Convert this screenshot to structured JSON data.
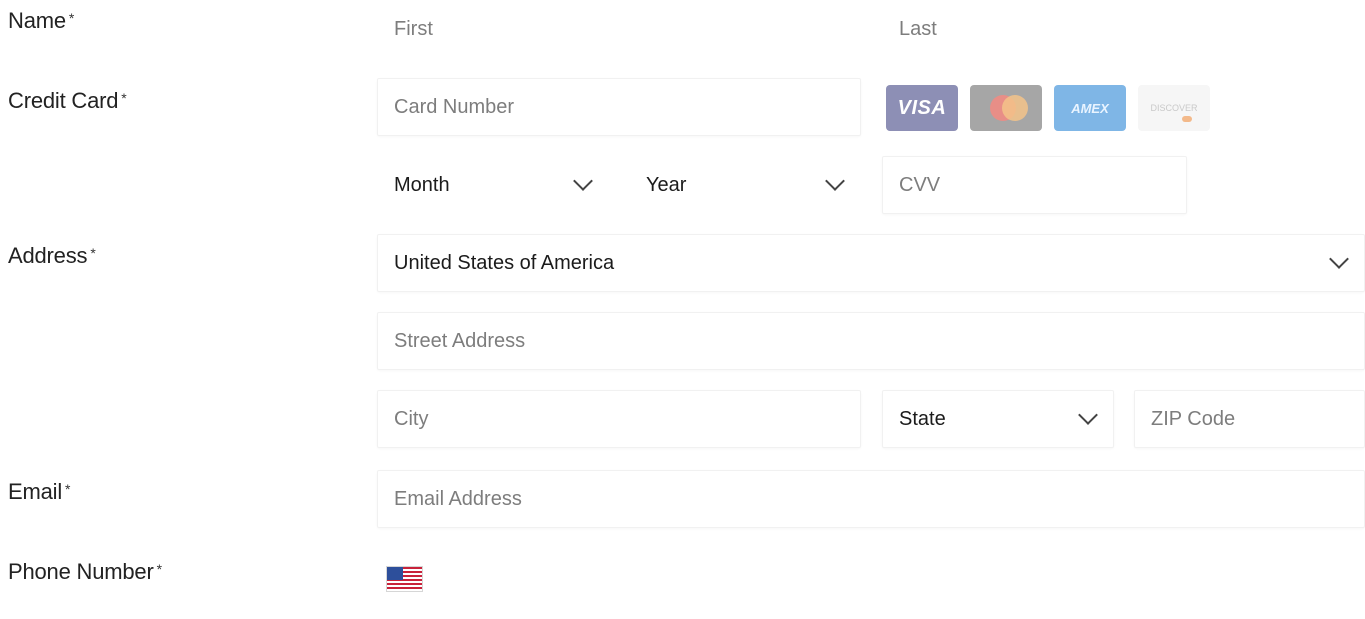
{
  "labels": {
    "name": "Name",
    "credit_card": "Credit Card",
    "address": "Address",
    "email": "Email",
    "phone": "Phone Number",
    "required_marker": "*"
  },
  "name": {
    "first_placeholder": "First",
    "last_placeholder": "Last"
  },
  "credit_card": {
    "number_placeholder": "Card Number",
    "card_brands": [
      "VISA",
      "Mastercard",
      "AMEX",
      "Discover"
    ],
    "visa_text": "VISA",
    "amex_text": "AMEX",
    "discover_text": "DISCOVER",
    "month_value": "Month",
    "year_value": "Year",
    "cvv_placeholder": "CVV"
  },
  "address": {
    "country_value": "United States of America",
    "street_placeholder": "Street Address",
    "city_placeholder": "City",
    "state_value": "State",
    "zip_placeholder": "ZIP Code"
  },
  "email": {
    "placeholder": "Email Address"
  },
  "phone": {
    "country_flag": "us-flag-icon",
    "value": ""
  },
  "colors": {
    "visa": "#8d8fb5",
    "mastercard": "#a6a6a6",
    "amex": "#7fb6e6",
    "discover": "#f6f6f6"
  }
}
